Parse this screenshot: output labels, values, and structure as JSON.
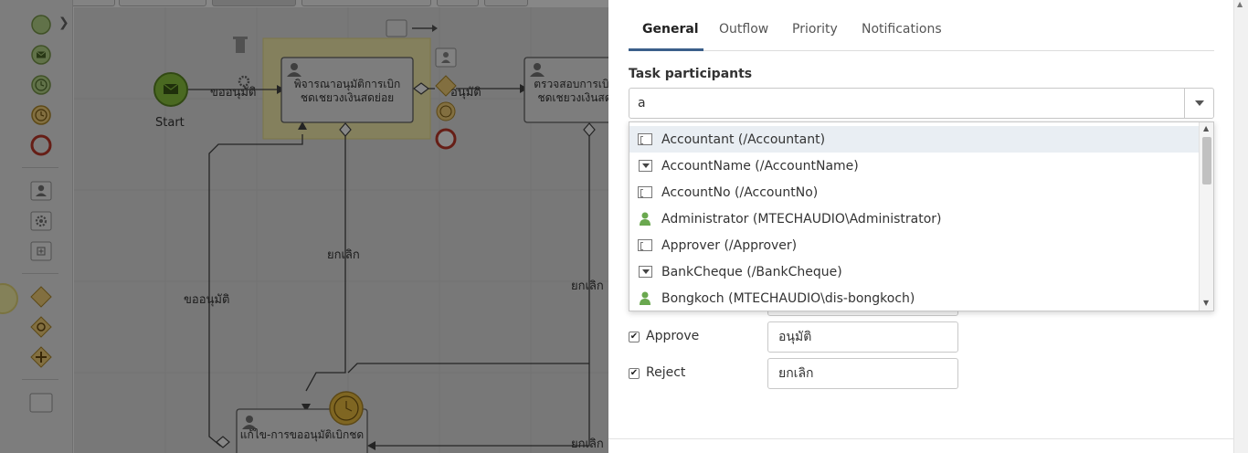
{
  "canvas": {
    "start_label": "Start",
    "task1_label": "พิจารณาอนุมัติการเบิกชดเชยวงเงินสดย่อย",
    "task2_label": "ตรวจสอบการเบิกชดเชยวงเงินสด",
    "task3_label": "แก้ไข-การขออนุมัติเบิกชด",
    "flow_request": "ขออนุมัติ",
    "flow_approve": "อนุมัติ",
    "flow_cancel_1": "ยกเลิก",
    "flow_request_2": "ขออนุมัติ",
    "flow_cancel_2": "ยกเลิก",
    "flow_cancel_3": "ยกเลิก"
  },
  "panel": {
    "tabs": [
      {
        "label": "General",
        "active": true
      },
      {
        "label": "Outflow",
        "active": false
      },
      {
        "label": "Priority",
        "active": false
      },
      {
        "label": "Notifications",
        "active": false
      }
    ],
    "participants_label": "Task participants",
    "participant_input_value": "a",
    "dropdown_items": [
      {
        "label": "Accountant (/Accountant)",
        "icon": "variable-icon",
        "highlight": true
      },
      {
        "label": "AccountName (/AccountName)",
        "icon": "list-icon",
        "highlight": false
      },
      {
        "label": "AccountNo (/AccountNo)",
        "icon": "variable-icon",
        "highlight": false
      },
      {
        "label": "Administrator (MTECHAUDIO\\Administrator)",
        "icon": "user-icon",
        "highlight": false
      },
      {
        "label": "Approver (/Approver)",
        "icon": "variable-icon",
        "highlight": false
      },
      {
        "label": "BankCheque (/BankCheque)",
        "icon": "list-icon",
        "highlight": false
      },
      {
        "label": "Bongkoch (MTECHAUDIO\\dis-bongkoch)",
        "icon": "user-icon",
        "highlight": false
      }
    ],
    "results": [
      {
        "label": "Approve",
        "checked": true,
        "value": "อนุมัติ"
      },
      {
        "label": "Reject",
        "checked": true,
        "value": "ยกเลิก"
      }
    ]
  },
  "colors": {
    "user_icon": "#6aa84f",
    "start_event": "#8cc63f",
    "end_event": "#c0392b",
    "timer_event": "#f0c040",
    "tab_underline": "#3b5f8a"
  }
}
